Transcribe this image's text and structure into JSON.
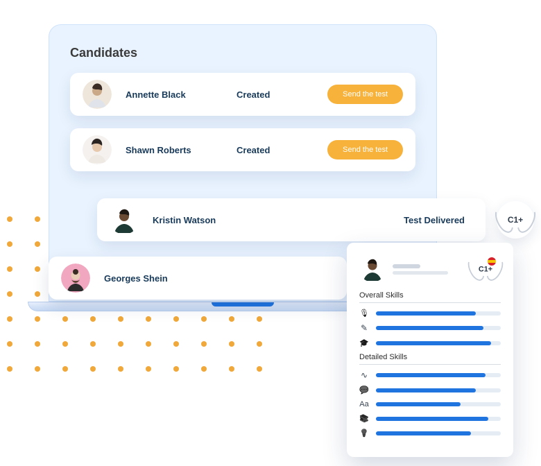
{
  "title": "Candidates",
  "rows": [
    {
      "name": "Annette Black",
      "status": "Created",
      "action": "Send the test"
    },
    {
      "name": "Shawn Roberts",
      "status": "Created",
      "action": "Send the test"
    },
    {
      "name": "Kristin Watson",
      "status": "Test Delivered",
      "badge": "C1+"
    },
    {
      "name": "Georges Shein"
    }
  ],
  "report": {
    "badge": "C1+",
    "sections": {
      "overall": {
        "title": "Overall Skills",
        "skills": [
          {
            "icon": "mic-icon",
            "pct": 80
          },
          {
            "icon": "pencil-icon",
            "pct": 86
          },
          {
            "icon": "grad-icon",
            "pct": 92
          }
        ]
      },
      "detailed": {
        "title": "Detailed Skills",
        "skills": [
          {
            "icon": "wave-icon",
            "pct": 88
          },
          {
            "icon": "chat-icon",
            "pct": 80
          },
          {
            "icon": "aa-icon",
            "pct": 68
          },
          {
            "icon": "books-icon",
            "pct": 90
          },
          {
            "icon": "bulb-icon",
            "pct": 76
          }
        ]
      }
    }
  }
}
